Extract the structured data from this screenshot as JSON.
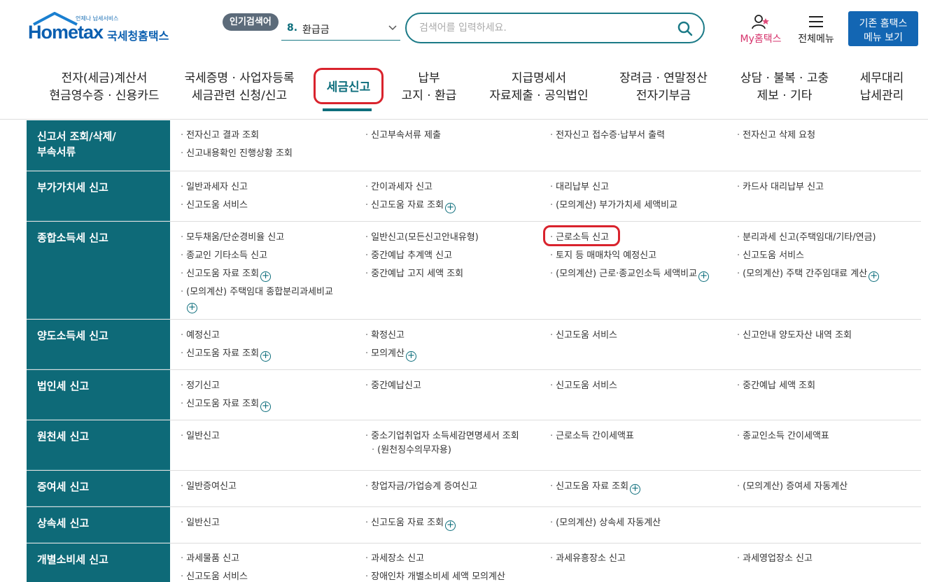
{
  "header": {
    "logo_sub": "언제나 납세서비스",
    "logo_main": "Hometax",
    "logo_kr": "국세청홈택스",
    "popular_badge": "인기검색어",
    "popular_rank": "8.",
    "popular_word": "환급금",
    "search_placeholder": "검색어를 입력하세요.",
    "my_hometax": "My홈택스",
    "all_menu": "전체메뉴",
    "old_button_line1": "기존 홈택스",
    "old_button_line2": "메뉴 보기"
  },
  "nav": [
    {
      "l1": "전자(세금)계산서",
      "l2": "현금영수증 · 신용카드"
    },
    {
      "l1": "국세증명 · 사업자등록",
      "l2": "세금관련 신청/신고"
    },
    {
      "l1": "세금신고",
      "l2": ""
    },
    {
      "l1": "납부",
      "l2": "고지 · 환급"
    },
    {
      "l1": "지급명세서",
      "l2": "자료제출 · 공익법인"
    },
    {
      "l1": "장려금 · 연말정산",
      "l2": "전자기부금"
    },
    {
      "l1": "상담 · 불복 · 고충",
      "l2": "제보 · 기타"
    },
    {
      "l1": "세무대리",
      "l2": "납세관리"
    }
  ],
  "rows": [
    {
      "head": "신고서 조회/삭제/\n부속서류",
      "items": [
        "전자신고 결과 조회",
        "신고부속서류 제출",
        "전자신고 접수증·납부서 출력",
        "전자신고 삭제 요청",
        "신고내용확인 진행상황 조회"
      ]
    },
    {
      "head": "부가가치세 신고",
      "items": [
        "일반과세자 신고",
        "간이과세자 신고",
        "대리납부 신고",
        "카드사 대리납부 신고",
        "신고도움 서비스",
        "신고도움 자료 조회",
        "(모의계산) 부가가치세 세액비교"
      ]
    },
    {
      "head": "종합소득세 신고",
      "items": [
        "모두채움/단순경비율 신고",
        "일반신고(모든신고안내유형)",
        "근로소득 신고",
        "분리과세 신고(주택임대/기타/연금)",
        "종교인 기타소득 신고",
        "중간예납 추계액 신고",
        "토지 등 매매차익 예정신고",
        "신고도움 서비스",
        "신고도움 자료 조회",
        "중간예납 고지 세액 조회",
        "(모의계산) 근로·종교인소득 세액비교",
        "(모의계산) 주택 간주임대료 계산",
        "(모의계산) 주택임대 종합분리과세비교"
      ]
    },
    {
      "head": "양도소득세 신고",
      "items": [
        "예정신고",
        "확정신고",
        "신고도움 서비스",
        "신고안내 양도자산 내역 조회",
        "신고도움 자료 조회",
        "모의계산"
      ]
    },
    {
      "head": "법인세 신고",
      "items": [
        "정기신고",
        "중간예납신고",
        "신고도움 서비스",
        "중간예납 세액 조회",
        "신고도움 자료 조회"
      ]
    },
    {
      "head": "원천세 신고",
      "items": [
        "일반신고",
        "중소기업취업자 소득세감면명세서 조회",
        "(원천징수의무자용)",
        "근로소득 간이세액표",
        "종교인소득 간이세액표"
      ]
    },
    {
      "head": "증여세 신고",
      "items": [
        "일반증여신고",
        "창업자금/가업승계 증여신고",
        "신고도움 자료 조회",
        "(모의계산) 증여세 자동계산"
      ]
    },
    {
      "head": "상속세 신고",
      "items": [
        "일반신고",
        "신고도움 자료 조회",
        "(모의계산) 상속세 자동계산"
      ]
    },
    {
      "head": "개별소비세 신고",
      "items": [
        "과세물품 신고",
        "과세장소 신고",
        "과세유흥장소 신고",
        "과세영업장소 신고",
        "신고도움 서비스",
        "장애인차 개별소비세 세액 모의계산"
      ]
    }
  ],
  "plus_symbol": "+",
  "colors": {
    "teal": "#0e6a78",
    "highlight": "#d9232d",
    "brand_blue": "#1366b3"
  }
}
